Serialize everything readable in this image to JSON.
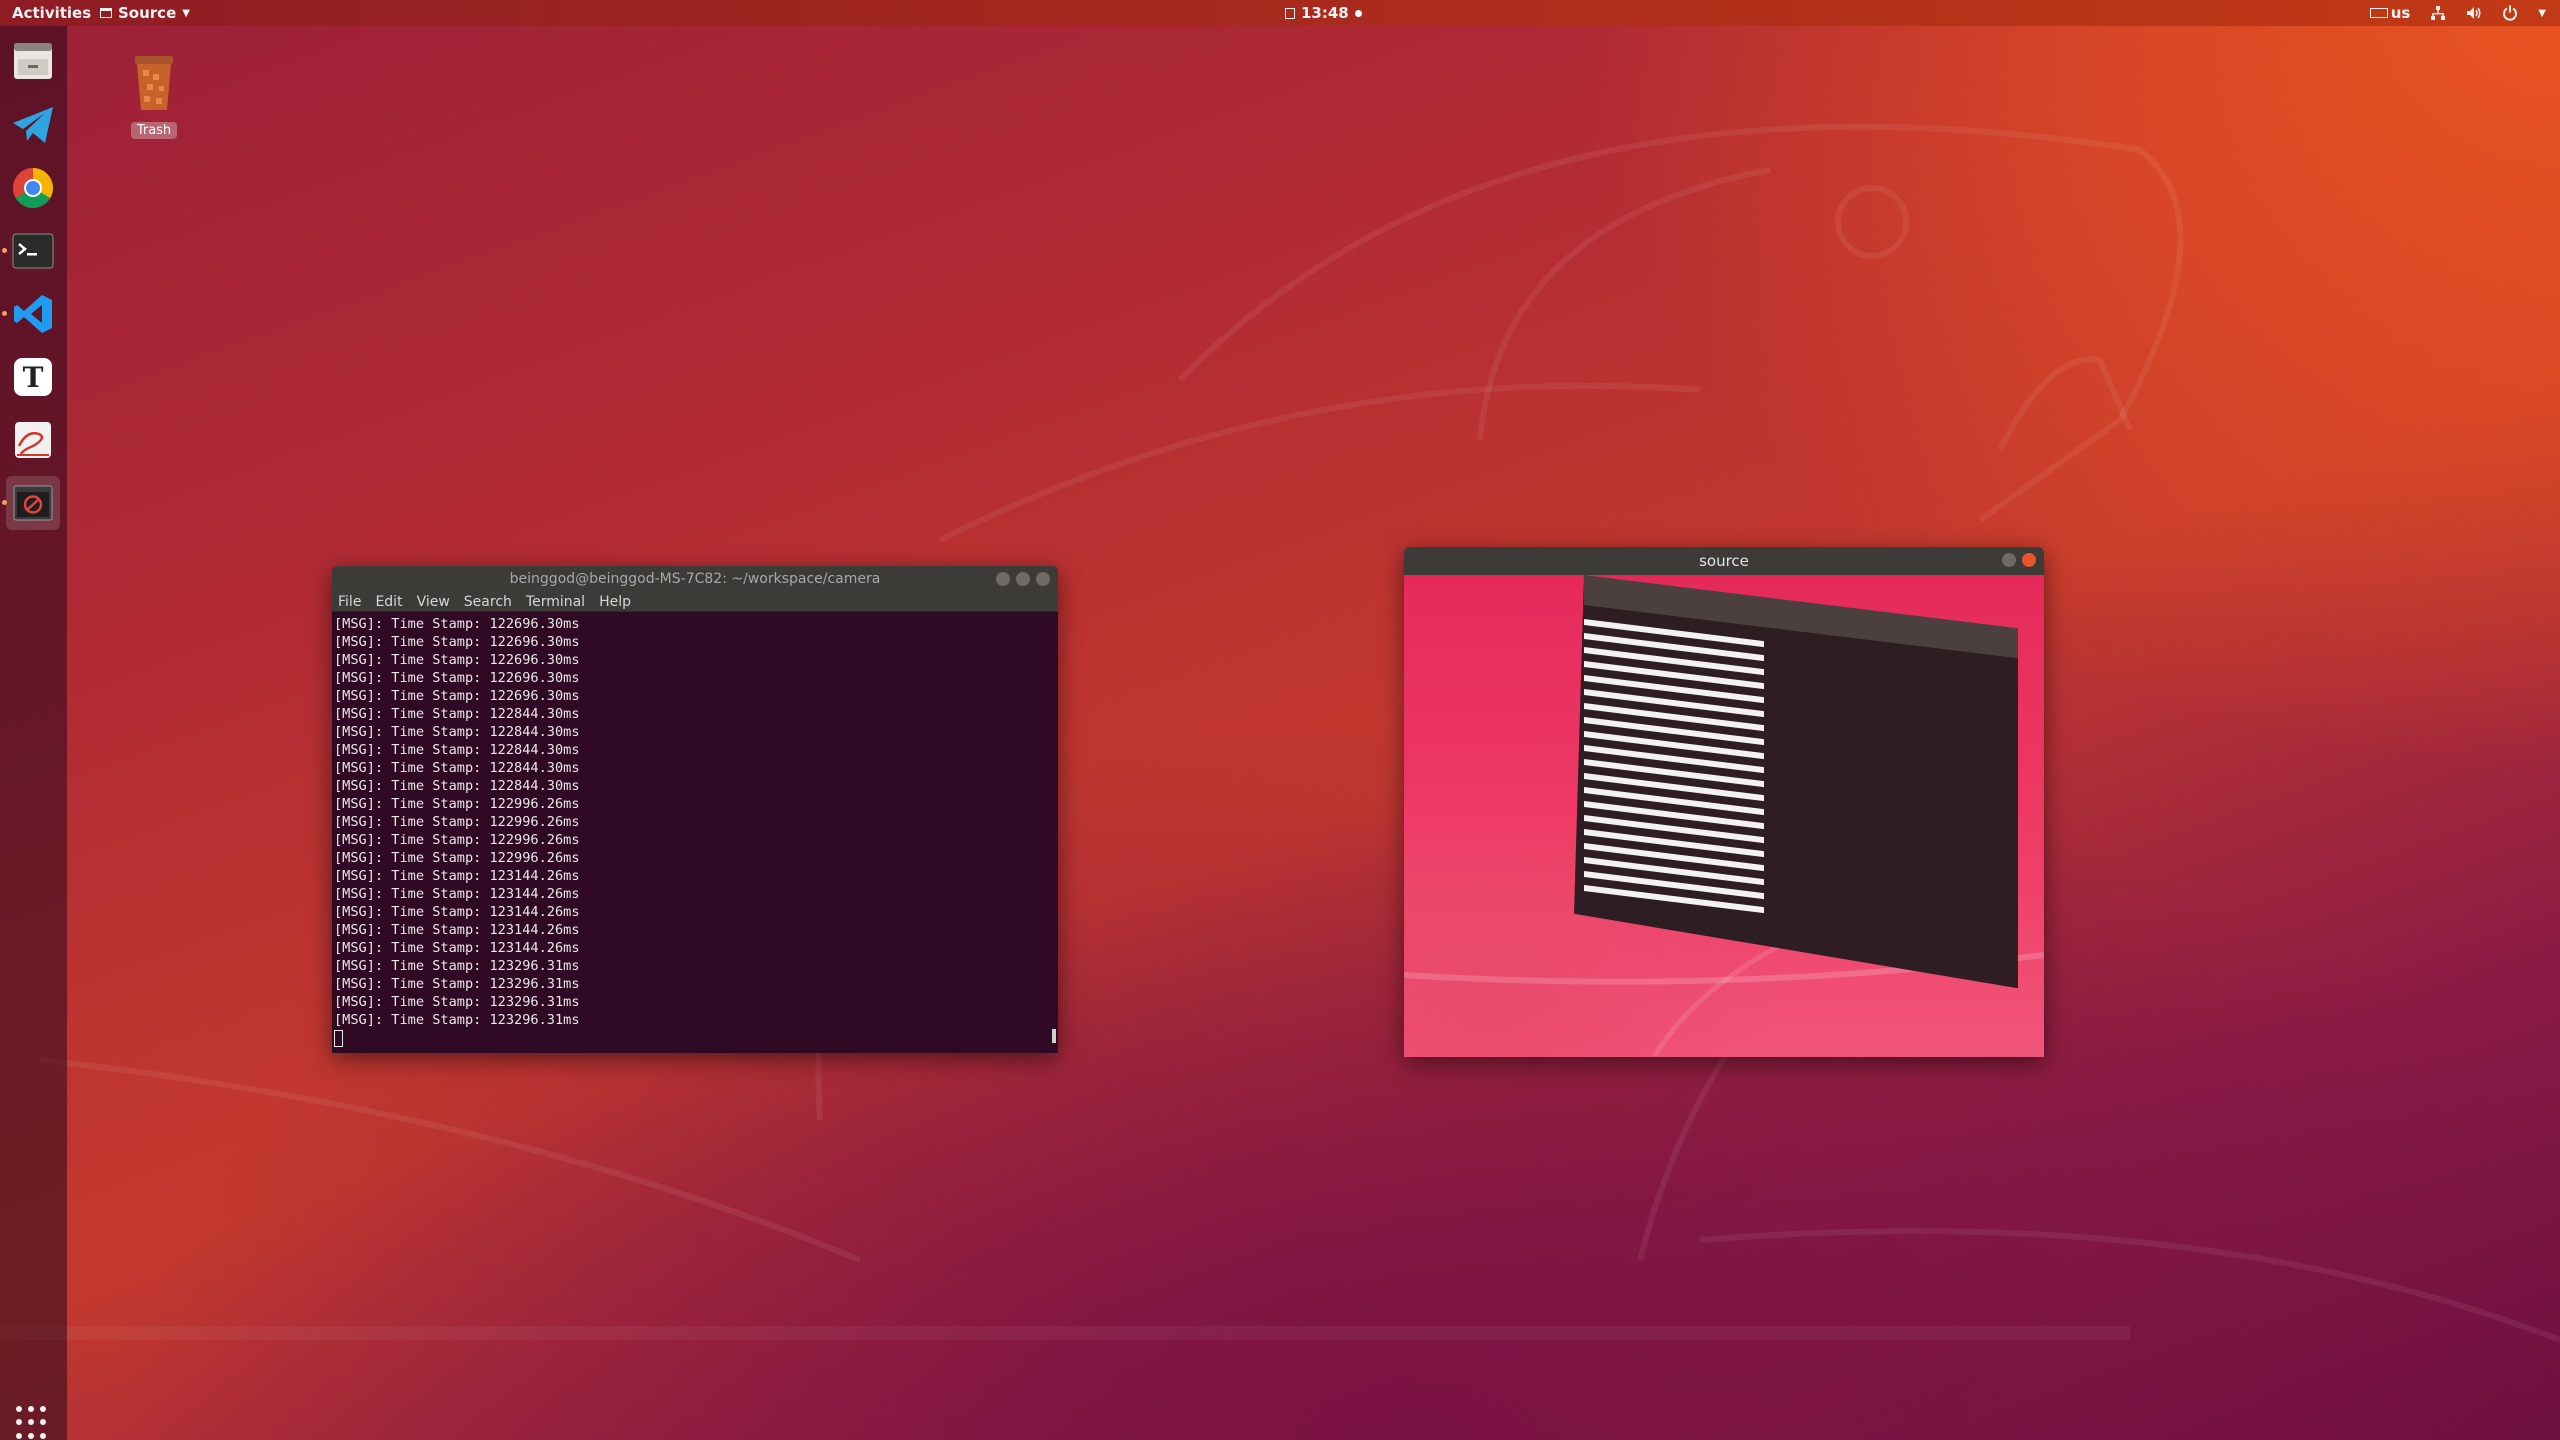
{
  "top_bar": {
    "activities": "Activities",
    "app_menu": "Source",
    "clock": "13:48",
    "keyboard_layout": "us"
  },
  "dock": {
    "items": [
      {
        "name": "files",
        "icon": "file-cabinet-icon"
      },
      {
        "name": "telegram",
        "icon": "paper-plane-icon"
      },
      {
        "name": "chrome",
        "icon": "chrome-icon"
      },
      {
        "name": "terminal",
        "icon": "terminal-icon"
      },
      {
        "name": "vscode",
        "icon": "vscode-icon"
      },
      {
        "name": "typora",
        "icon": "letter-t-icon"
      },
      {
        "name": "text-editor",
        "icon": "pen-paper-icon"
      },
      {
        "name": "source-viewer",
        "icon": "camera-window-icon"
      }
    ],
    "show_apps_icon": "grid-icon"
  },
  "desktop": {
    "trash_label": "Trash"
  },
  "terminal": {
    "title": "beinggod@beinggod-MS-7C82: ~/workspace/camera",
    "menu": [
      "File",
      "Edit",
      "View",
      "Search",
      "Terminal",
      "Help"
    ],
    "lines": [
      "[MSG]: Time Stamp: 122696.30ms",
      "[MSG]: Time Stamp: 122696.30ms",
      "[MSG]: Time Stamp: 122696.30ms",
      "[MSG]: Time Stamp: 122696.30ms",
      "[MSG]: Time Stamp: 122696.30ms",
      "[MSG]: Time Stamp: 122844.30ms",
      "[MSG]: Time Stamp: 122844.30ms",
      "[MSG]: Time Stamp: 122844.30ms",
      "[MSG]: Time Stamp: 122844.30ms",
      "[MSG]: Time Stamp: 122844.30ms",
      "[MSG]: Time Stamp: 122996.26ms",
      "[MSG]: Time Stamp: 122996.26ms",
      "[MSG]: Time Stamp: 122996.26ms",
      "[MSG]: Time Stamp: 122996.26ms",
      "[MSG]: Time Stamp: 123144.26ms",
      "[MSG]: Time Stamp: 123144.26ms",
      "[MSG]: Time Stamp: 123144.26ms",
      "[MSG]: Time Stamp: 123144.26ms",
      "[MSG]: Time Stamp: 123144.26ms",
      "[MSG]: Time Stamp: 123296.31ms",
      "[MSG]: Time Stamp: 123296.31ms",
      "[MSG]: Time Stamp: 123296.31ms",
      "[MSG]: Time Stamp: 123296.31ms"
    ]
  },
  "source_window": {
    "title": "source"
  },
  "colors": {
    "ubuntu_orange": "#e95420",
    "aubergine": "#300a24",
    "titlebar": "#3c3b37",
    "close_button": "#e9542e"
  }
}
